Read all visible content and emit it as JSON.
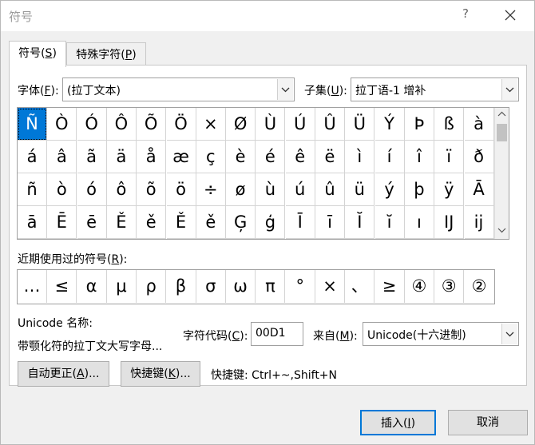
{
  "window": {
    "title": "符号",
    "help": "?"
  },
  "tabs": [
    {
      "label": "符号(",
      "key": "S",
      "after": ")"
    },
    {
      "label": "特殊字符(",
      "key": "P",
      "after": ")"
    }
  ],
  "font": {
    "label": "字体(",
    "key": "F",
    "after": "):",
    "value": "(拉丁文本)"
  },
  "subset": {
    "label": "子集(",
    "key": "U",
    "after": "):",
    "value": "拉丁语-1 增补"
  },
  "symbols": [
    [
      "Ñ",
      "Ò",
      "Ó",
      "Ô",
      "Õ",
      "Ö",
      "×",
      "Ø",
      "Ù",
      "Ú",
      "Û",
      "Ü",
      "Ý",
      "Þ",
      "ß",
      "à"
    ],
    [
      "á",
      "â",
      "ã",
      "ä",
      "å",
      "æ",
      "ç",
      "è",
      "é",
      "ê",
      "ë",
      "ì",
      "í",
      "î",
      "ï",
      "ð"
    ],
    [
      "ñ",
      "ò",
      "ó",
      "ô",
      "õ",
      "ö",
      "÷",
      "ø",
      "ù",
      "ú",
      "û",
      "ü",
      "ý",
      "þ",
      "ÿ",
      "Ā"
    ],
    [
      "ā",
      "Ē",
      "ē",
      "Ě",
      "ě",
      "Ě",
      "ě",
      "Ģ",
      "ģ",
      "Ī",
      "ī",
      "Ĭ",
      "ĭ",
      "ı",
      "Ĳ",
      "ĳ"
    ]
  ],
  "recent": {
    "label": "近期使用过的符号(",
    "key": "R",
    "after": "):",
    "items": [
      "…",
      "≤",
      "α",
      "μ",
      "ρ",
      "β",
      "σ",
      "ω",
      "π",
      "°",
      "×",
      "、",
      "≥",
      "④",
      "③",
      "②"
    ]
  },
  "unicode_name": {
    "label": "Unicode 名称:",
    "value": "带颚化符的拉丁文大写字母..."
  },
  "char_code": {
    "label": "字符代码(",
    "key": "C",
    "after": "):",
    "value": "00D1"
  },
  "from": {
    "label": "来自(",
    "key": "M",
    "after": "):",
    "value": "Unicode(十六进制)"
  },
  "buttons": {
    "autocorrect": {
      "label": "自动更正(",
      "key": "A",
      "after": ")..."
    },
    "shortcut_key": {
      "label": "快捷键(",
      "key": "K",
      "after": ")..."
    },
    "insert": {
      "label": "插入(",
      "key": "I",
      "after": ")"
    },
    "cancel": "取消"
  },
  "shortcut_text": "快捷键: Ctrl+~,Shift+N"
}
